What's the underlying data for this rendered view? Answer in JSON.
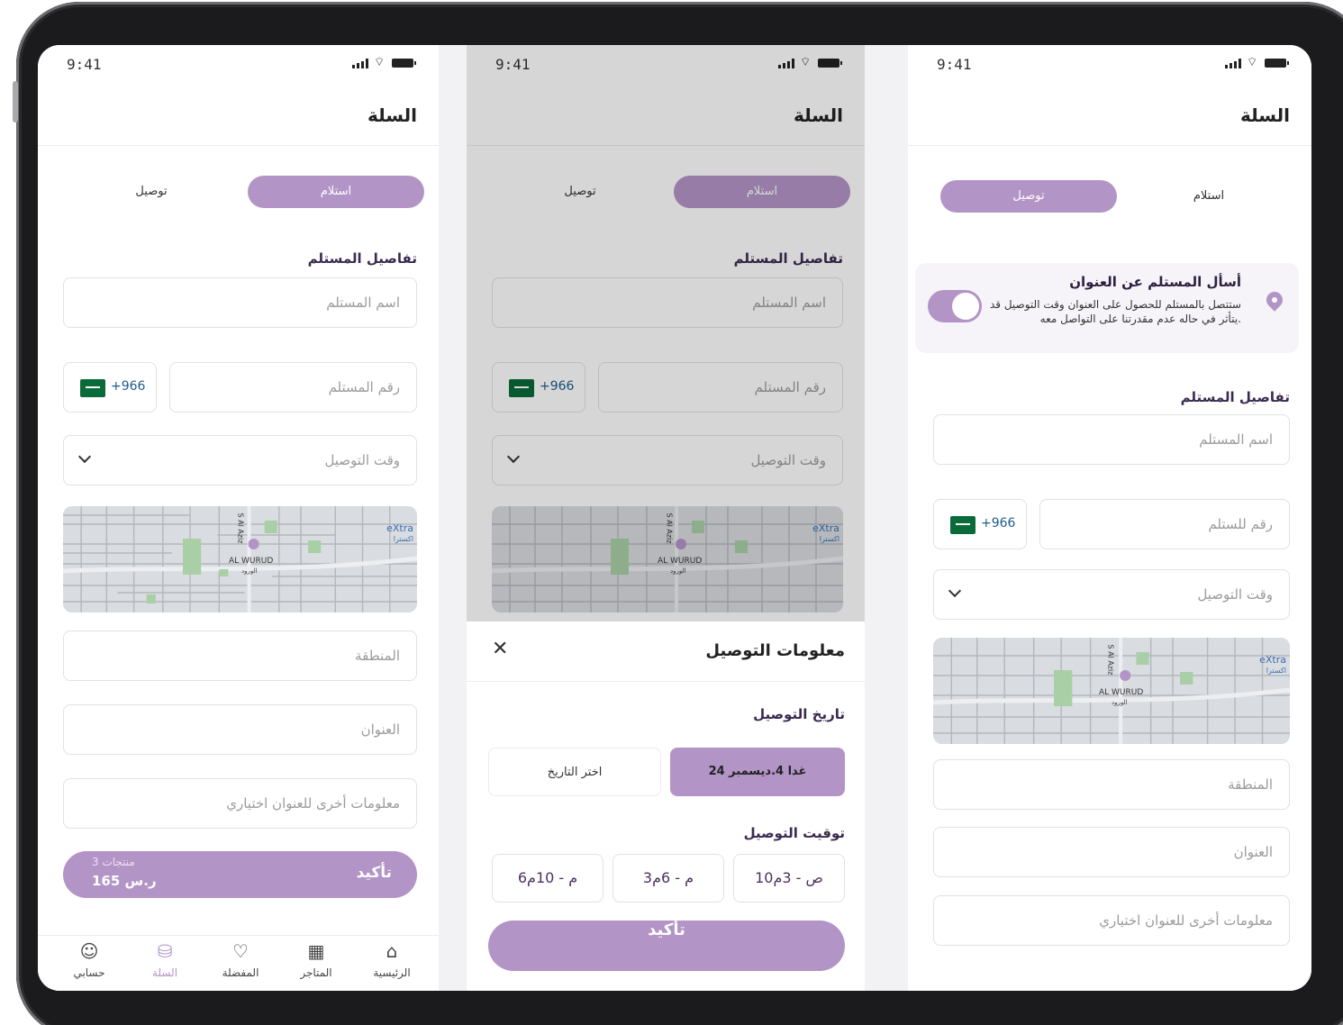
{
  "status": {
    "time": "9:41"
  },
  "header": {
    "title": "السلة"
  },
  "segment": {
    "pickup": "استلام",
    "delivery": "توصيل"
  },
  "recipient": {
    "section_title": "تفاصيل المستلم",
    "name_placeholder": "اسم المستلم",
    "phone_placeholder": "رقم المستلم",
    "phone_placeholder_alt": "رقم للستلم",
    "country_code": "+966",
    "delivery_time_placeholder": "وقت التوصيل",
    "area_placeholder": "المنطقة",
    "address_placeholder": "العنوان",
    "extra_placeholder": "معلومات أخرى للعنوان اختياري"
  },
  "map": {
    "district": "AL WURUD",
    "district_ar": "الورود",
    "store": "eXtra",
    "store_ar": "اكسترا",
    "street": "S Al Aziz"
  },
  "cart_bar": {
    "confirm": "تأكيد",
    "count": "3 منتجات",
    "price": "165 ر.س"
  },
  "tabs": [
    {
      "label": "حسابي",
      "icon": "user-icon"
    },
    {
      "label": "السلة",
      "icon": "basket-icon"
    },
    {
      "label": "المفضلة",
      "icon": "heart-icon"
    },
    {
      "label": "المتاجر",
      "icon": "store-icon"
    },
    {
      "label": "الرئيسية",
      "icon": "home-icon"
    }
  ],
  "sheet": {
    "title": "معلومات التوصيل",
    "date_label": "تاريخ التوصيل",
    "date_selected": "غدا 4.ديسمبر 24",
    "date_pick": "اختر التاريخ",
    "time_label": "توقيت التوصيل",
    "slots": [
      "10ص - 3م",
      "3م - 6م",
      "6م - 10م"
    ],
    "confirm": "تأكيد"
  },
  "ask": {
    "title": "أسأل المستلم عن العنوان",
    "description": "ستتصل بالمستلم للحصول على العنوان وقت التوصيل قد يتأثر في حاله عدم مقدرتنا على التواصل معه.",
    "enabled": true
  },
  "colors": {
    "accent": "#b394c6",
    "text": "#222222",
    "label": "#3a2a50",
    "placeholder": "#9b9b9f"
  }
}
